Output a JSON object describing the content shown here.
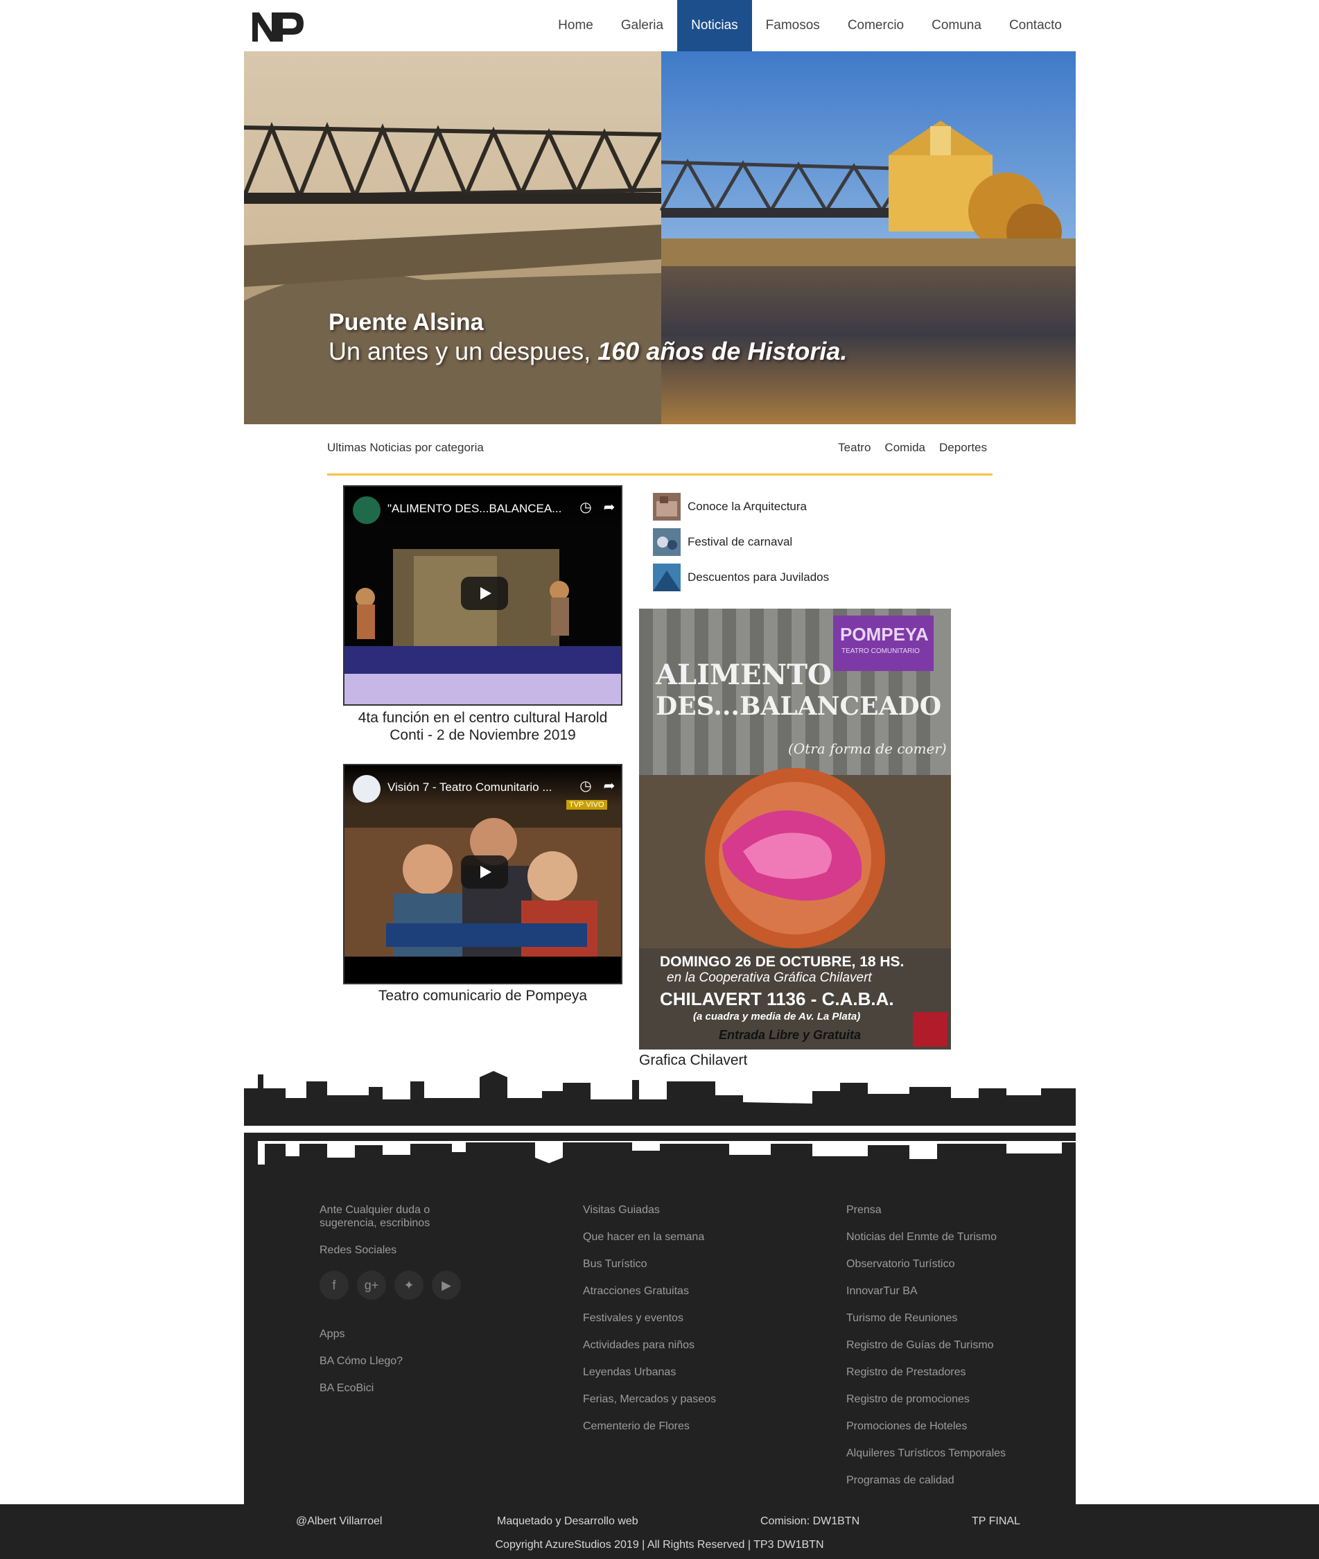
{
  "nav": {
    "logo": "NP",
    "items": [
      "Home",
      "Galeria",
      "Noticias",
      "Famosos",
      "Comercio",
      "Comuna",
      "Contacto"
    ],
    "active": "Noticias"
  },
  "hero": {
    "title": "Puente Alsina",
    "subtitle_plain": "Un antes y un despues, ",
    "subtitle_bold": "160 años de Historia."
  },
  "categories": {
    "title": "Ultimas Noticias por categoria",
    "links": [
      "Teatro",
      "Comida",
      "Deportes"
    ]
  },
  "videos": [
    {
      "title": "\"ALIMENTO DES...BALANCEA...",
      "caption": "4ta función en el centro cultural Harold Conti - 2 de Noviembre 2019"
    },
    {
      "title": "Visión 7 - Teatro Comunitario ...",
      "caption": "Teatro comunicario de Pompeya",
      "badge": "TVP VIVO"
    }
  ],
  "side_news": [
    "Conoce la Arquitectura",
    "Festival de carnaval",
    "Descuentos para Juvilados"
  ],
  "poster": {
    "brand": "POMPEYA",
    "brand_sub": "TEATRO COMUNITARIO",
    "line1": "ALIMENTO",
    "line2": "DES...BALANCEADO",
    "line3": "(Otra forma de comer)",
    "date": "DOMINGO 26 DE OCTUBRE, 18 HS.",
    "place": "en la Cooperativa Gráfica Chilavert",
    "address": "CHILAVERT 1136 - C.A.B.A.",
    "directions": "(a cuadra y media de Av. La Plata)",
    "entry": "Entrada Libre y Gratuita",
    "caption": "Grafica Chilavert"
  },
  "footer": {
    "col1": {
      "contact": "Ante Cualquier duda o sugerencia, escribinos",
      "social_title": "Redes Sociales",
      "social_icons": [
        "facebook-icon",
        "google-plus-icon",
        "twitter-icon",
        "youtube-icon"
      ],
      "apps_title": "Apps",
      "apps": [
        "BA Cómo Llego?",
        "BA EcoBici"
      ]
    },
    "col2": [
      "Visitas Guiadas",
      "Que hacer en la semana",
      "Bus Turístico",
      "Atracciones Gratuitas",
      "Festivales y eventos",
      "Actividades para niños",
      "Leyendas Urbanas",
      "Ferias, Mercados y paseos",
      "Cementerio de Flores"
    ],
    "col3": [
      "Prensa",
      "Noticias del Enmte de Turismo",
      "Observatorio Turístico",
      "InnovarTur BA",
      "Turismo de Reuniones",
      "Registro de Guías de Turismo",
      "Registro de Prestadores",
      "Registro de promociones",
      "Promociones de Hoteles",
      "Alquileres Turísticos Temporales",
      "Programas de calidad"
    ]
  },
  "bottom": {
    "author": "@Albert Villarroel",
    "role": "Maquetado y Desarrollo web",
    "commission": "Comision: DW1BTN",
    "project": "TP FINAL",
    "copyright": "Copyright AzureStudios 2019 | All Rights Reserved | TP3 DW1BTN"
  }
}
